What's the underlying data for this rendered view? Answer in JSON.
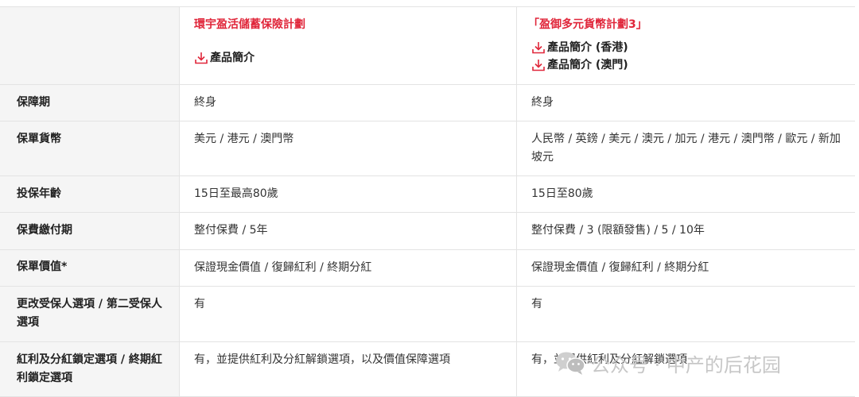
{
  "plans": [
    {
      "name": "環宇盈活儲蓄保險計劃",
      "brochures": [
        "產品簡介"
      ]
    },
    {
      "name": "「盈御多元貨幣計劃3」",
      "brochures": [
        "產品簡介 (香港)",
        "產品簡介 (澳門)"
      ]
    }
  ],
  "rows": [
    {
      "label": "保障期",
      "values": [
        "終身",
        "終身"
      ]
    },
    {
      "label": "保單貨幣",
      "values": [
        "美元 / 港元 / 澳門幣",
        "人民幣 / 英鎊 / 美元 / 澳元 / 加元 / 港元 / 澳門幣 / 歐元 / 新加坡元"
      ]
    },
    {
      "label": "投保年齡",
      "values": [
        "15日至最高80歲",
        "15日至80歲"
      ]
    },
    {
      "label": "保費繳付期",
      "values": [
        "整付保費 / 5年",
        "整付保費 / 3 (限額發售) / 5 / 10年"
      ]
    },
    {
      "label": "保單價值*",
      "values": [
        "保證現金價值 / 復歸紅利 / 終期分紅",
        "保證現金價值 / 復歸紅利 / 終期分紅"
      ]
    },
    {
      "label": "更改受保人選項 / 第二受保人選項",
      "values": [
        "有",
        "有"
      ]
    },
    {
      "label": "紅利及分紅鎖定選項 / 終期紅利鎖定選項",
      "values": [
        "有，並提供紅利及分紅解鎖選項，以及價值保障選項",
        "有，並提供紅利及分紅解鎖選項"
      ]
    }
  ],
  "watermark": {
    "text": "公众号 · 中产的后花园",
    "icon": "wechat-icon"
  },
  "colors": {
    "accent": "#e0263a",
    "label_bg": "#f5f5f5",
    "border": "#e3e3e3"
  }
}
